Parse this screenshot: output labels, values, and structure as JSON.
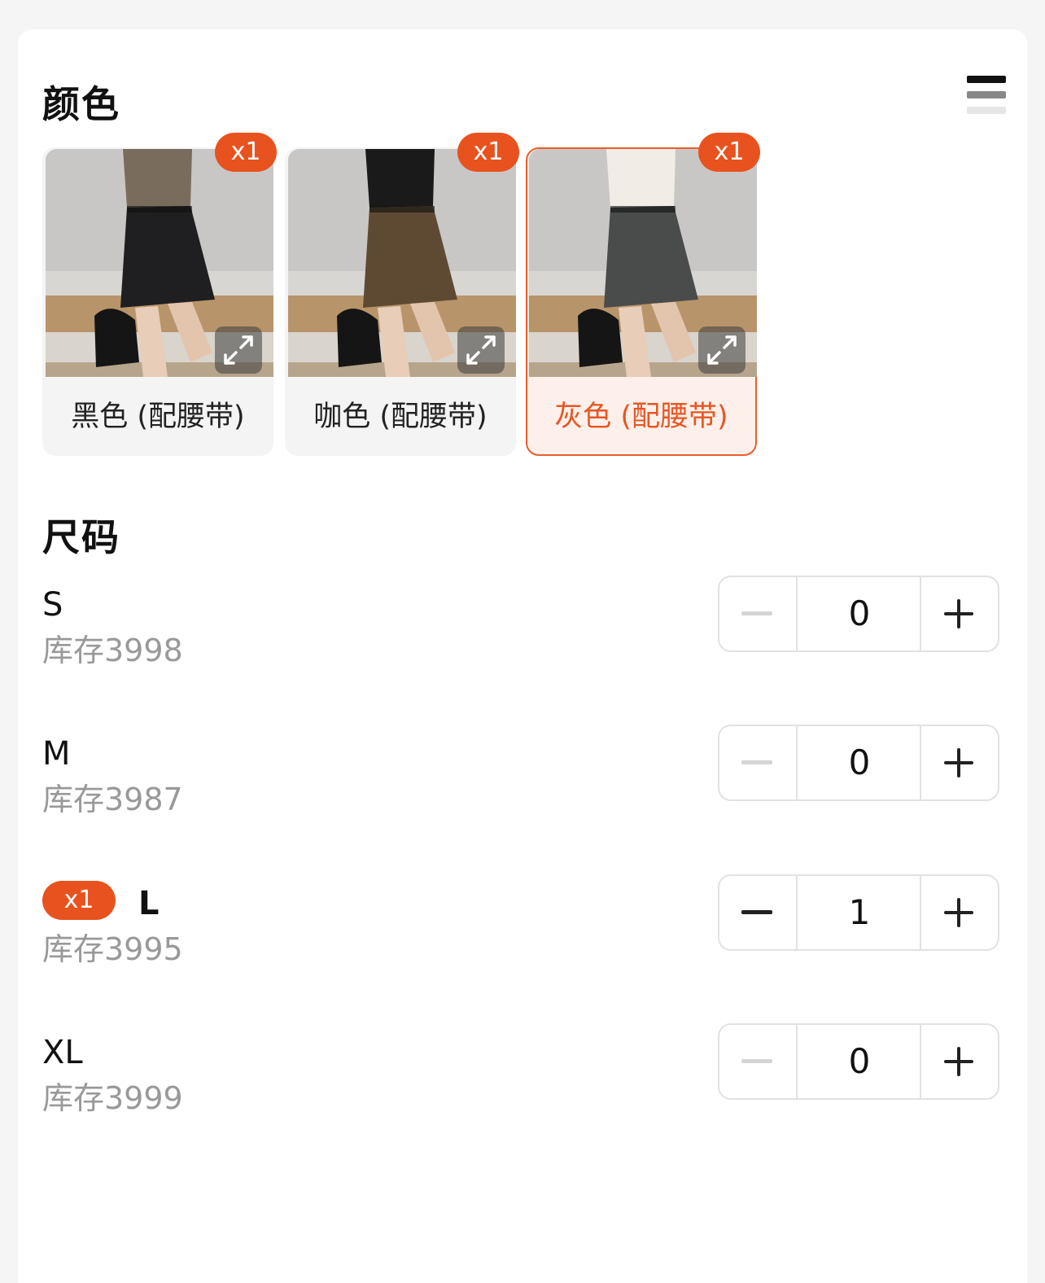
{
  "color_section": {
    "title": "颜色",
    "options": [
      {
        "label": "黑色 (配腰带)",
        "badge": "x1",
        "skirt_color": "#1f1f21",
        "top_color": "#7a6c5c",
        "selected": false
      },
      {
        "label": "咖色 (配腰带)",
        "badge": "x1",
        "skirt_color": "#5e4a33",
        "top_color": "#1a1a1a",
        "selected": false
      },
      {
        "label": "灰色 (配腰带)",
        "badge": "x1",
        "skirt_color": "#4a4b4b",
        "top_color": "#f1ede6",
        "selected": true
      }
    ]
  },
  "size_section": {
    "title": "尺码",
    "rows": [
      {
        "size": "S",
        "stock": "库存3998",
        "quantity": "0",
        "badge": ""
      },
      {
        "size": "M",
        "stock": "库存3987",
        "quantity": "0",
        "badge": ""
      },
      {
        "size": "L",
        "stock": "库存3995",
        "quantity": "1",
        "badge": "x1"
      },
      {
        "size": "XL",
        "stock": "库存3999",
        "quantity": "0",
        "badge": ""
      }
    ]
  },
  "colors": {
    "accent": "#e8521e",
    "stock_text": "#999999",
    "minus_disabled": "#d5d5d5",
    "minus_enabled": "#222222"
  },
  "icons": {
    "list_toggle": "list-view-icon",
    "expand": "expand-icon",
    "minus": "minus-icon",
    "plus": "plus-icon"
  }
}
